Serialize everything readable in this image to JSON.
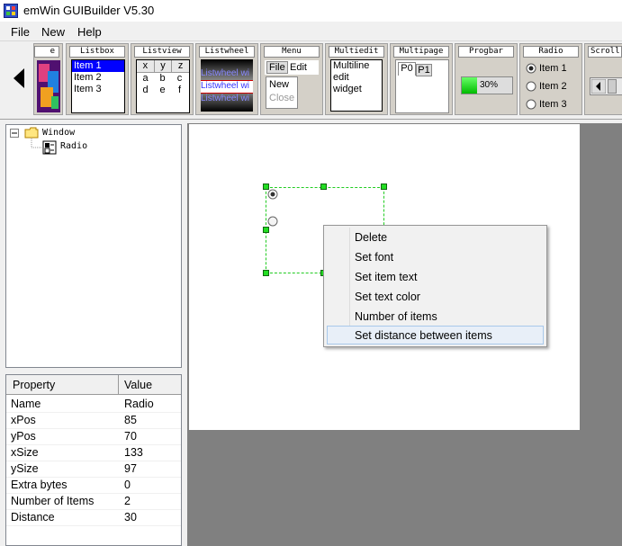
{
  "app": {
    "title": "emWin GUIBuilder V5.30"
  },
  "menubar": {
    "items": [
      "File",
      "New",
      "Help"
    ]
  },
  "toolbar": {
    "partial_first_label": "e",
    "listbox": {
      "label": "Listbox",
      "items": [
        "Item 1",
        "Item 2",
        "Item 3"
      ]
    },
    "listview": {
      "label": "Listview",
      "header": [
        "x",
        "y",
        "z"
      ],
      "row1": [
        "a",
        "b",
        "c"
      ],
      "row2": [
        "d",
        "e",
        "f"
      ]
    },
    "listwheel": {
      "label": "Listwheel",
      "lines": [
        "Listwheel wi",
        "Listwheel wi",
        "Listwheel wi"
      ]
    },
    "menu": {
      "label": "Menu",
      "items": [
        "File",
        "Edit"
      ],
      "submenu": [
        "New",
        "Close"
      ]
    },
    "multiedit": {
      "label": "Multiedit",
      "lines": [
        "Multiline",
        "edit",
        "widget"
      ]
    },
    "multipage": {
      "label": "Multipage",
      "tabs": [
        "P0",
        "P1"
      ]
    },
    "progbar": {
      "label": "Progbar",
      "value_text": "30%",
      "value": 30
    },
    "radio": {
      "label": "Radio",
      "items": [
        "Item 1",
        "Item 2",
        "Item 3"
      ]
    },
    "scroll": {
      "label": "Scroll"
    }
  },
  "tree": {
    "root": "Window",
    "child": "Radio"
  },
  "properties": {
    "header_property": "Property",
    "header_value": "Value",
    "rows": [
      {
        "name": "Name",
        "value": "Radio"
      },
      {
        "name": "xPos",
        "value": "85"
      },
      {
        "name": "yPos",
        "value": "70"
      },
      {
        "name": "xSize",
        "value": "133"
      },
      {
        "name": "ySize",
        "value": "97"
      },
      {
        "name": "Extra bytes",
        "value": "0"
      },
      {
        "name": "Number of Items",
        "value": "2"
      },
      {
        "name": "Distance",
        "value": "30"
      }
    ]
  },
  "context_menu": {
    "items": [
      "Delete",
      "Set font",
      "Set item text",
      "Set text color",
      "Number of items",
      "Set distance between items"
    ],
    "highlighted": "Set distance between items"
  },
  "colors": {
    "selection": "#0000ff",
    "handle": "#22dd22",
    "canvas": "#ffffff",
    "workspace": "#808080"
  }
}
